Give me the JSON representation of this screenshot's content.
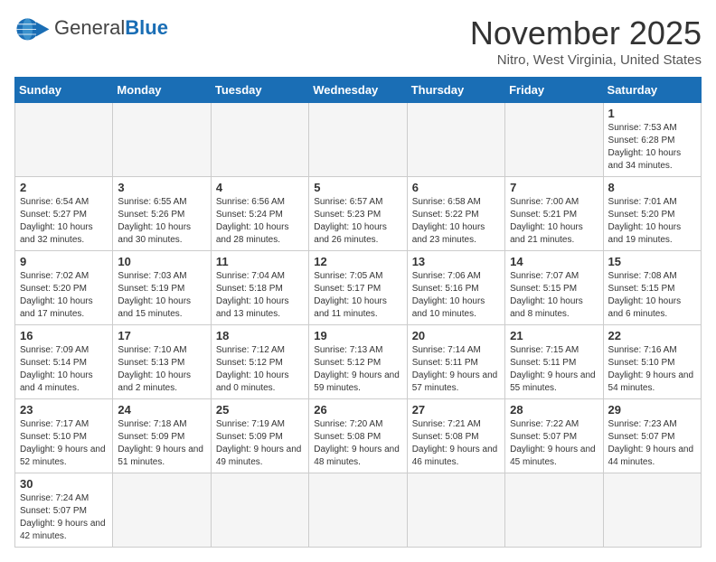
{
  "header": {
    "logo_general": "General",
    "logo_blue": "Blue",
    "month_title": "November 2025",
    "location": "Nitro, West Virginia, United States"
  },
  "days_of_week": [
    "Sunday",
    "Monday",
    "Tuesday",
    "Wednesday",
    "Thursday",
    "Friday",
    "Saturday"
  ],
  "weeks": [
    [
      {
        "day": "",
        "info": ""
      },
      {
        "day": "",
        "info": ""
      },
      {
        "day": "",
        "info": ""
      },
      {
        "day": "",
        "info": ""
      },
      {
        "day": "",
        "info": ""
      },
      {
        "day": "",
        "info": ""
      },
      {
        "day": "1",
        "info": "Sunrise: 7:53 AM\nSunset: 6:28 PM\nDaylight: 10 hours and 34 minutes."
      }
    ],
    [
      {
        "day": "2",
        "info": "Sunrise: 6:54 AM\nSunset: 5:27 PM\nDaylight: 10 hours and 32 minutes."
      },
      {
        "day": "3",
        "info": "Sunrise: 6:55 AM\nSunset: 5:26 PM\nDaylight: 10 hours and 30 minutes."
      },
      {
        "day": "4",
        "info": "Sunrise: 6:56 AM\nSunset: 5:24 PM\nDaylight: 10 hours and 28 minutes."
      },
      {
        "day": "5",
        "info": "Sunrise: 6:57 AM\nSunset: 5:23 PM\nDaylight: 10 hours and 26 minutes."
      },
      {
        "day": "6",
        "info": "Sunrise: 6:58 AM\nSunset: 5:22 PM\nDaylight: 10 hours and 23 minutes."
      },
      {
        "day": "7",
        "info": "Sunrise: 7:00 AM\nSunset: 5:21 PM\nDaylight: 10 hours and 21 minutes."
      },
      {
        "day": "8",
        "info": "Sunrise: 7:01 AM\nSunset: 5:20 PM\nDaylight: 10 hours and 19 minutes."
      }
    ],
    [
      {
        "day": "9",
        "info": "Sunrise: 7:02 AM\nSunset: 5:20 PM\nDaylight: 10 hours and 17 minutes."
      },
      {
        "day": "10",
        "info": "Sunrise: 7:03 AM\nSunset: 5:19 PM\nDaylight: 10 hours and 15 minutes."
      },
      {
        "day": "11",
        "info": "Sunrise: 7:04 AM\nSunset: 5:18 PM\nDaylight: 10 hours and 13 minutes."
      },
      {
        "day": "12",
        "info": "Sunrise: 7:05 AM\nSunset: 5:17 PM\nDaylight: 10 hours and 11 minutes."
      },
      {
        "day": "13",
        "info": "Sunrise: 7:06 AM\nSunset: 5:16 PM\nDaylight: 10 hours and 10 minutes."
      },
      {
        "day": "14",
        "info": "Sunrise: 7:07 AM\nSunset: 5:15 PM\nDaylight: 10 hours and 8 minutes."
      },
      {
        "day": "15",
        "info": "Sunrise: 7:08 AM\nSunset: 5:15 PM\nDaylight: 10 hours and 6 minutes."
      }
    ],
    [
      {
        "day": "16",
        "info": "Sunrise: 7:09 AM\nSunset: 5:14 PM\nDaylight: 10 hours and 4 minutes."
      },
      {
        "day": "17",
        "info": "Sunrise: 7:10 AM\nSunset: 5:13 PM\nDaylight: 10 hours and 2 minutes."
      },
      {
        "day": "18",
        "info": "Sunrise: 7:12 AM\nSunset: 5:12 PM\nDaylight: 10 hours and 0 minutes."
      },
      {
        "day": "19",
        "info": "Sunrise: 7:13 AM\nSunset: 5:12 PM\nDaylight: 9 hours and 59 minutes."
      },
      {
        "day": "20",
        "info": "Sunrise: 7:14 AM\nSunset: 5:11 PM\nDaylight: 9 hours and 57 minutes."
      },
      {
        "day": "21",
        "info": "Sunrise: 7:15 AM\nSunset: 5:11 PM\nDaylight: 9 hours and 55 minutes."
      },
      {
        "day": "22",
        "info": "Sunrise: 7:16 AM\nSunset: 5:10 PM\nDaylight: 9 hours and 54 minutes."
      }
    ],
    [
      {
        "day": "23",
        "info": "Sunrise: 7:17 AM\nSunset: 5:10 PM\nDaylight: 9 hours and 52 minutes."
      },
      {
        "day": "24",
        "info": "Sunrise: 7:18 AM\nSunset: 5:09 PM\nDaylight: 9 hours and 51 minutes."
      },
      {
        "day": "25",
        "info": "Sunrise: 7:19 AM\nSunset: 5:09 PM\nDaylight: 9 hours and 49 minutes."
      },
      {
        "day": "26",
        "info": "Sunrise: 7:20 AM\nSunset: 5:08 PM\nDaylight: 9 hours and 48 minutes."
      },
      {
        "day": "27",
        "info": "Sunrise: 7:21 AM\nSunset: 5:08 PM\nDaylight: 9 hours and 46 minutes."
      },
      {
        "day": "28",
        "info": "Sunrise: 7:22 AM\nSunset: 5:07 PM\nDaylight: 9 hours and 45 minutes."
      },
      {
        "day": "29",
        "info": "Sunrise: 7:23 AM\nSunset: 5:07 PM\nDaylight: 9 hours and 44 minutes."
      }
    ],
    [
      {
        "day": "30",
        "info": "Sunrise: 7:24 AM\nSunset: 5:07 PM\nDaylight: 9 hours and 42 minutes."
      },
      {
        "day": "",
        "info": ""
      },
      {
        "day": "",
        "info": ""
      },
      {
        "day": "",
        "info": ""
      },
      {
        "day": "",
        "info": ""
      },
      {
        "day": "",
        "info": ""
      },
      {
        "day": "",
        "info": ""
      }
    ]
  ]
}
